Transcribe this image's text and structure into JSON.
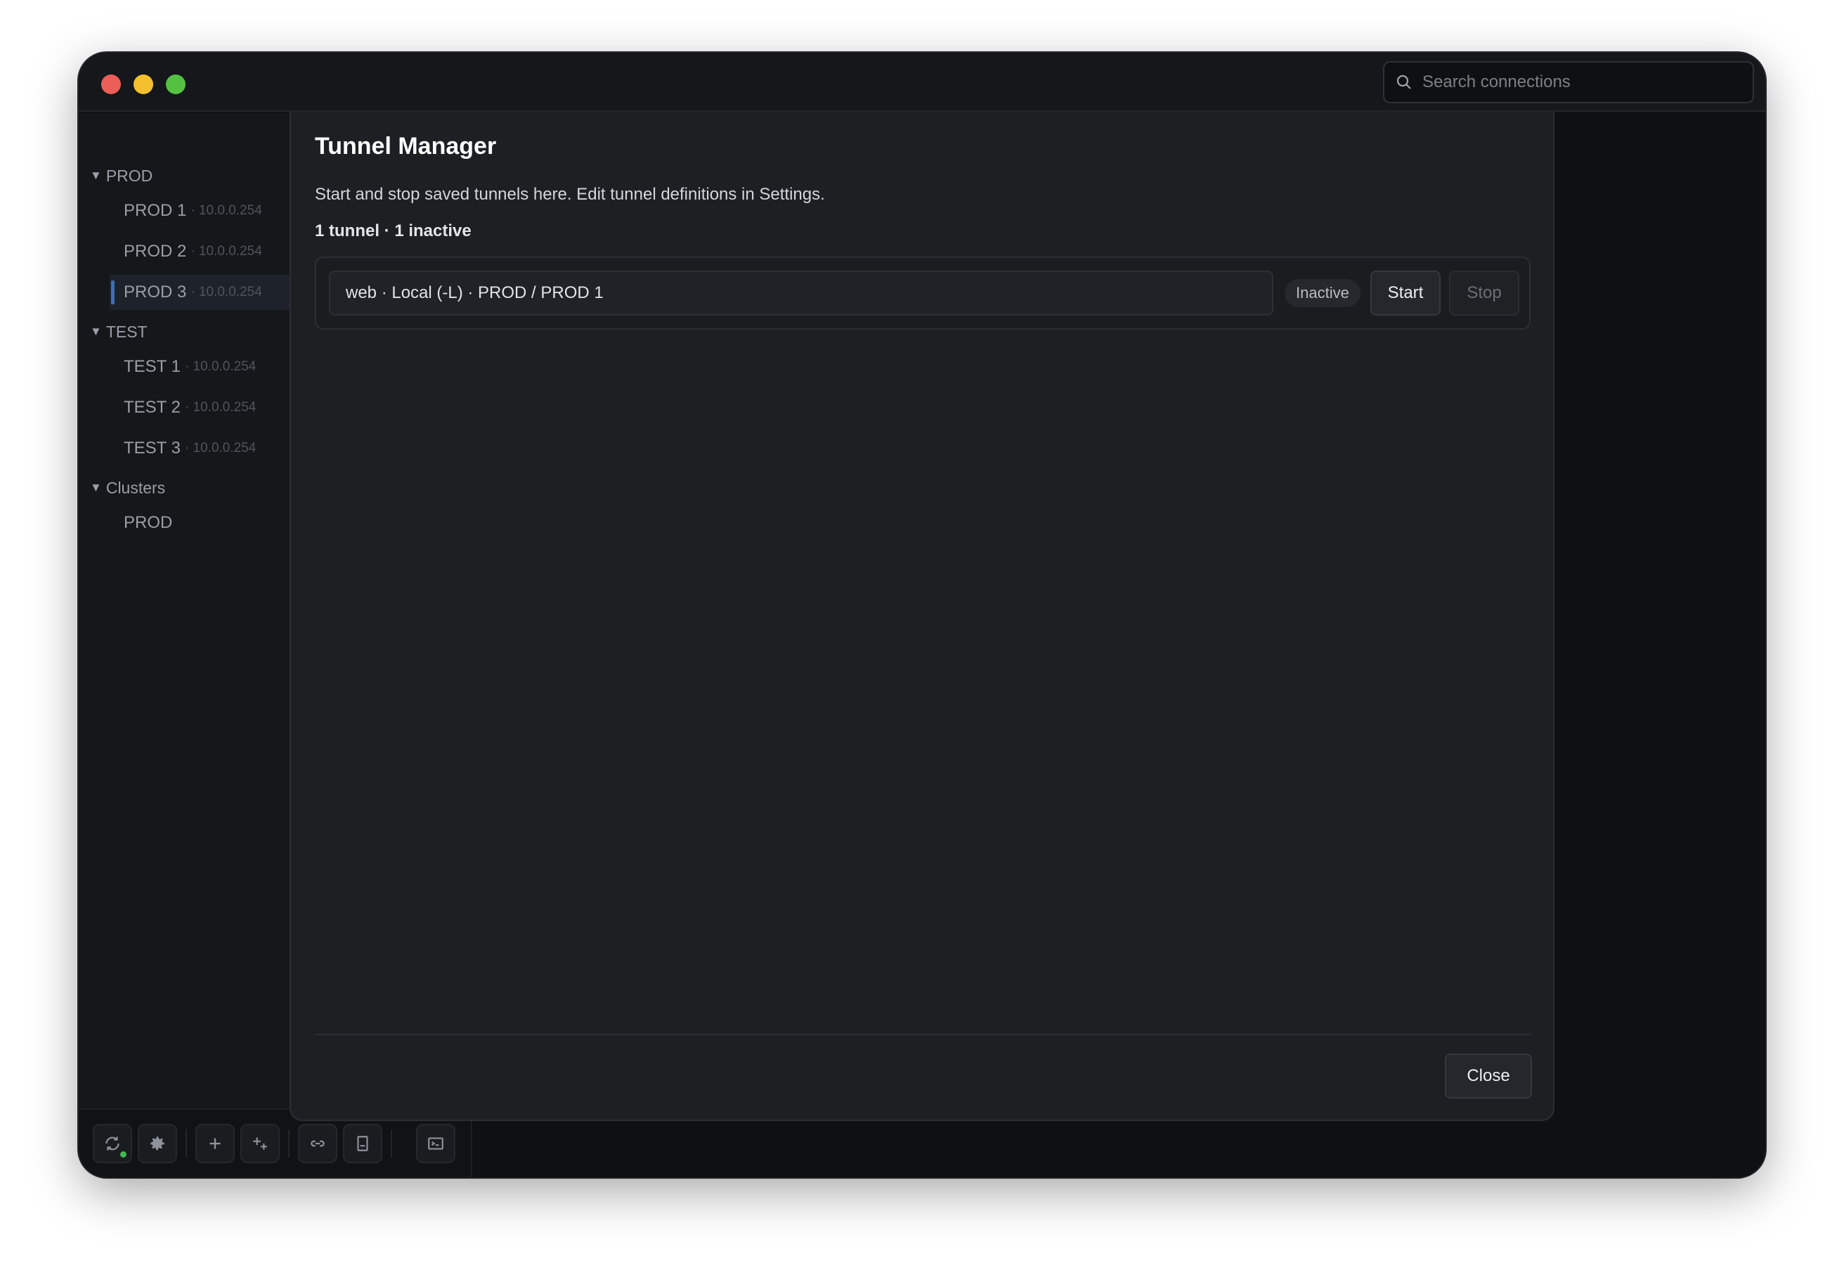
{
  "window": {
    "search_placeholder": "Search connections"
  },
  "sidebar": {
    "groups": [
      {
        "name": "PROD",
        "items": [
          {
            "label": "PROD 1",
            "ip": "· 10.0.0.254"
          },
          {
            "label": "PROD 2",
            "ip": "· 10.0.0.254"
          },
          {
            "label": "PROD 3",
            "ip": "· 10.0.0.254",
            "selected": true
          }
        ]
      },
      {
        "name": "TEST",
        "items": [
          {
            "label": "TEST 1",
            "ip": "· 10.0.0.254"
          },
          {
            "label": "TEST 2",
            "ip": "· 10.0.0.254"
          },
          {
            "label": "TEST 3",
            "ip": "· 10.0.0.254"
          }
        ]
      },
      {
        "name": "Clusters",
        "items": [
          {
            "label": "PROD",
            "ip": ""
          }
        ]
      }
    ]
  },
  "toolbar": {
    "icons": [
      "sync-icon",
      "gear-icon",
      "plus-icon",
      "plus-sparkle-icon",
      "link-icon",
      "bookmark-icon",
      "terminal-icon"
    ],
    "sync_status_color": "#3fb950"
  },
  "dialog": {
    "title": "Tunnel Manager",
    "description": "Start and stop saved tunnels here. Edit tunnel definitions in Settings.",
    "summary": "1 tunnel · 1 inactive",
    "tunnels": [
      {
        "description": "web · Local (-L) · PROD / PROD 1",
        "status": "Inactive",
        "start_label": "Start",
        "stop_label": "Stop"
      }
    ],
    "close_label": "Close"
  },
  "colors": {
    "accent": "#3e6fb3",
    "traffic_red": "#ec5f58",
    "traffic_yellow": "#f4c02e",
    "traffic_green": "#55c143"
  }
}
